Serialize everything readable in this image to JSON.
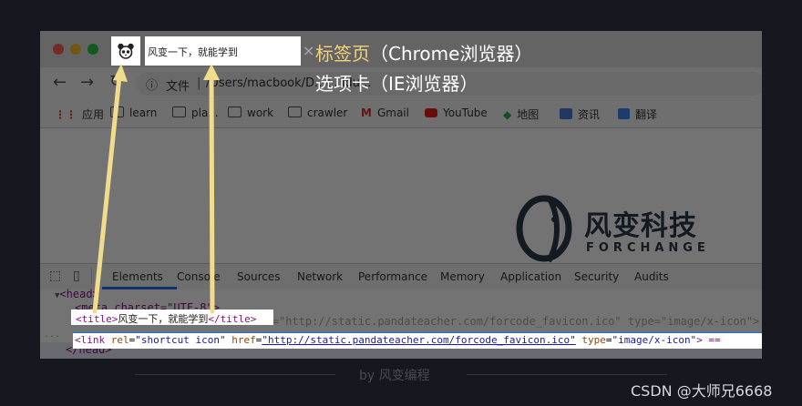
{
  "tab": {
    "title": "风变一下，就能学到",
    "close": "×"
  },
  "address": {
    "scheme_label": "文件",
    "path": "/Users/macbook/D...t...ldu..."
  },
  "bookmarks": [
    "应用",
    "learn",
    "pla...",
    "work",
    "crawler",
    "Gmail",
    "YouTube",
    "地图",
    "资讯",
    "翻译"
  ],
  "page_logo": {
    "name": "风变科技",
    "sub": "FORCHANGE"
  },
  "devtools": {
    "tabs": [
      "Elements",
      "Console",
      "Sources",
      "Network",
      "Performance",
      "Memory",
      "Application",
      "Security",
      "Audits"
    ],
    "lines": {
      "head_open": "<head>",
      "meta": "<meta charset=\"UTF-8\">",
      "title_open": "<title>",
      "title_text": "风变一下，就能学到",
      "title_close": "</title>",
      "link_tag": "<link",
      "link_rel_attr": "rel",
      "link_rel_val": "\"shortcut icon\"",
      "link_href_attr": "href",
      "link_href_val": "\"http://static.pandateacher.com/forcode_favicon.ico\"",
      "link_type_attr": "type",
      "link_type_val": "\"image/x-icon\"",
      "link_end": "> ==",
      "head_close": "</head>",
      "ellipsis": "..."
    }
  },
  "annotations": {
    "line1_a": "标签页",
    "line1_b": "（Chrome浏览器）",
    "line2": "选项卡（IE浏览器）"
  },
  "caption": "by 风变编程",
  "watermark": "CSDN @大师兄6668",
  "colors": {
    "background": "#17171f",
    "annotation_yellow": "#f3d27a",
    "arrow_yellow": "#f0dc8c",
    "highlight_blue": "#1b6fd6"
  }
}
